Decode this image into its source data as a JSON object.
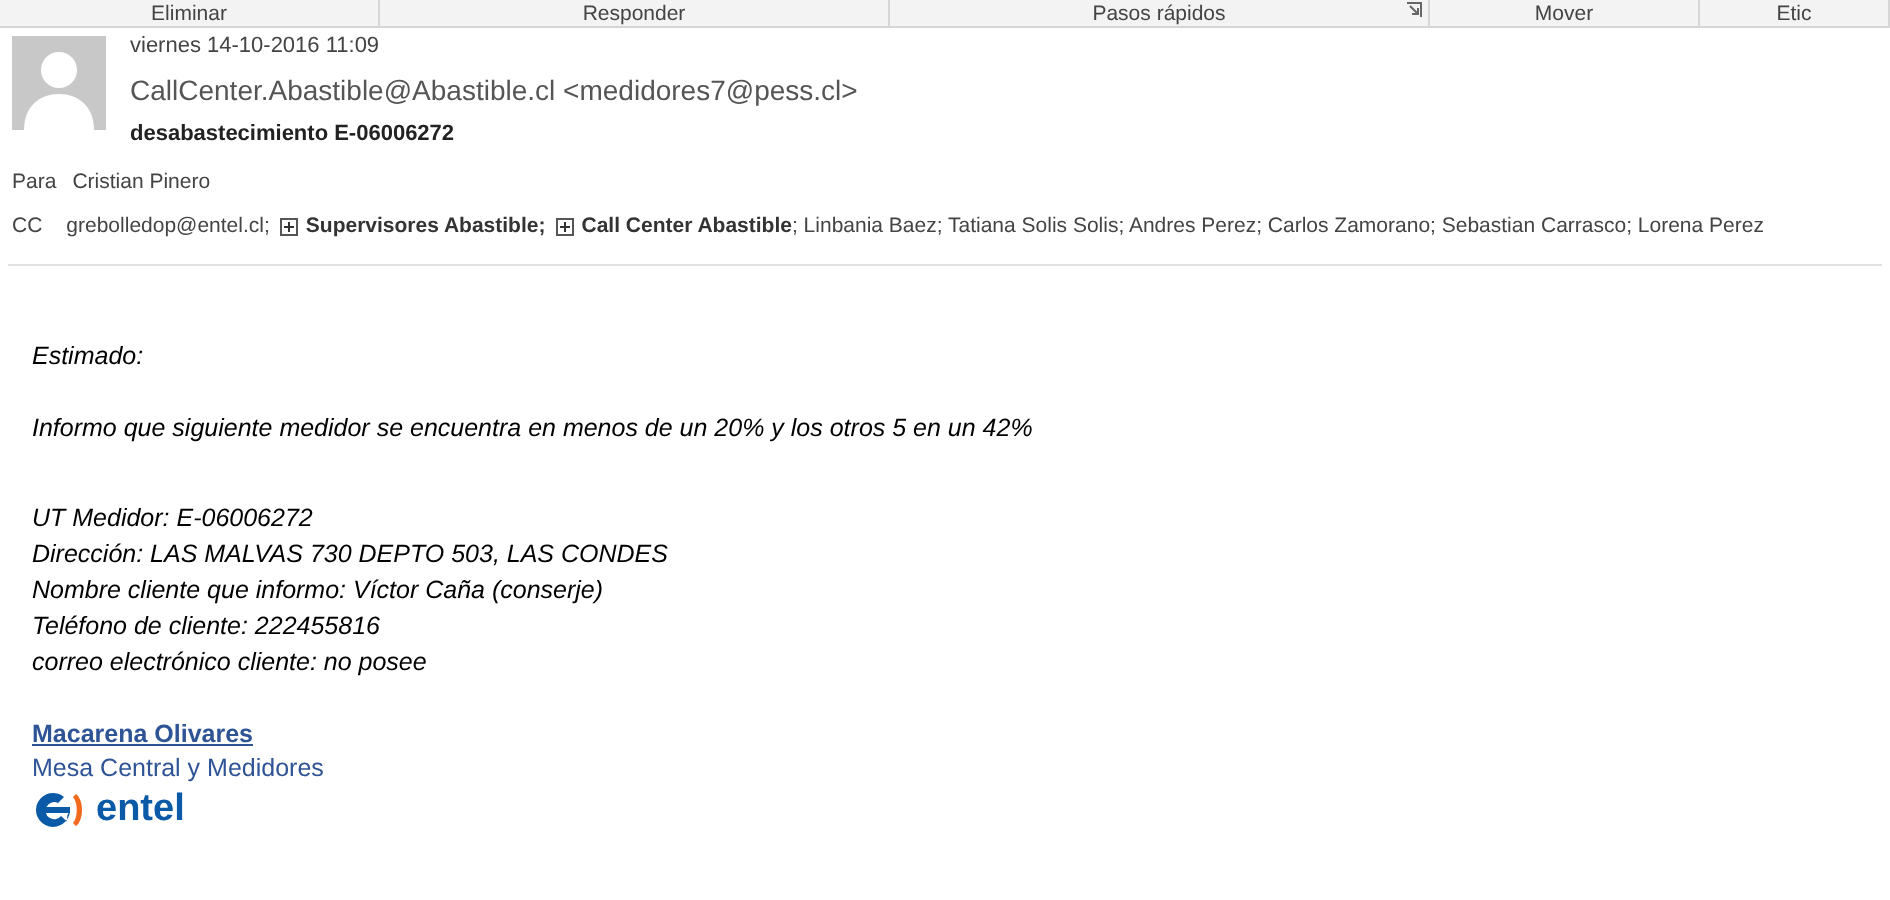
{
  "ribbon_groups": [
    {
      "label": "Eliminar",
      "launcher": false
    },
    {
      "label": "Responder",
      "launcher": false
    },
    {
      "label": "Pasos rápidos",
      "launcher": true
    },
    {
      "label": "Mover",
      "launcher": false
    },
    {
      "label": "Etic",
      "launcher": false
    }
  ],
  "header": {
    "date": "viernes 14-10-2016 11:09",
    "from": "CallCenter.Abastible@Abastible.cl <medidores7@pess.cl>",
    "subject": "desabastecimiento E-06006272",
    "to_label": "Para",
    "to": "Cristian Pinero",
    "cc_label": "CC",
    "cc": [
      {
        "kind": "person",
        "text": "grebolledop@entel.cl;"
      },
      {
        "kind": "group",
        "text": "Supervisores Abastible;"
      },
      {
        "kind": "group",
        "text": "Call Center Abastible"
      },
      {
        "kind": "person",
        "text": "; Linbania Baez; Tatiana Solis Solis; Andres Perez; Carlos Zamorano; Sebastian Carrasco; Lorena Perez"
      }
    ]
  },
  "body": {
    "greeting": "Estimado:",
    "paragraph": "Informo que siguiente medidor se encuentra en menos de un 20% y los otros 5 en un 42%",
    "details": [
      "UT Medidor: E-06006272",
      "Dirección: LAS MALVAS 730 DEPTO 503, LAS CONDES",
      "Nombre cliente que informo: Víctor Caña (conserje)",
      "Teléfono de cliente: 222455816",
      "correo electrónico cliente: no posee"
    ],
    "signature": {
      "name": "Macarena Olivares",
      "title": "Mesa Central y Medidores",
      "logo_text": "entel"
    }
  }
}
